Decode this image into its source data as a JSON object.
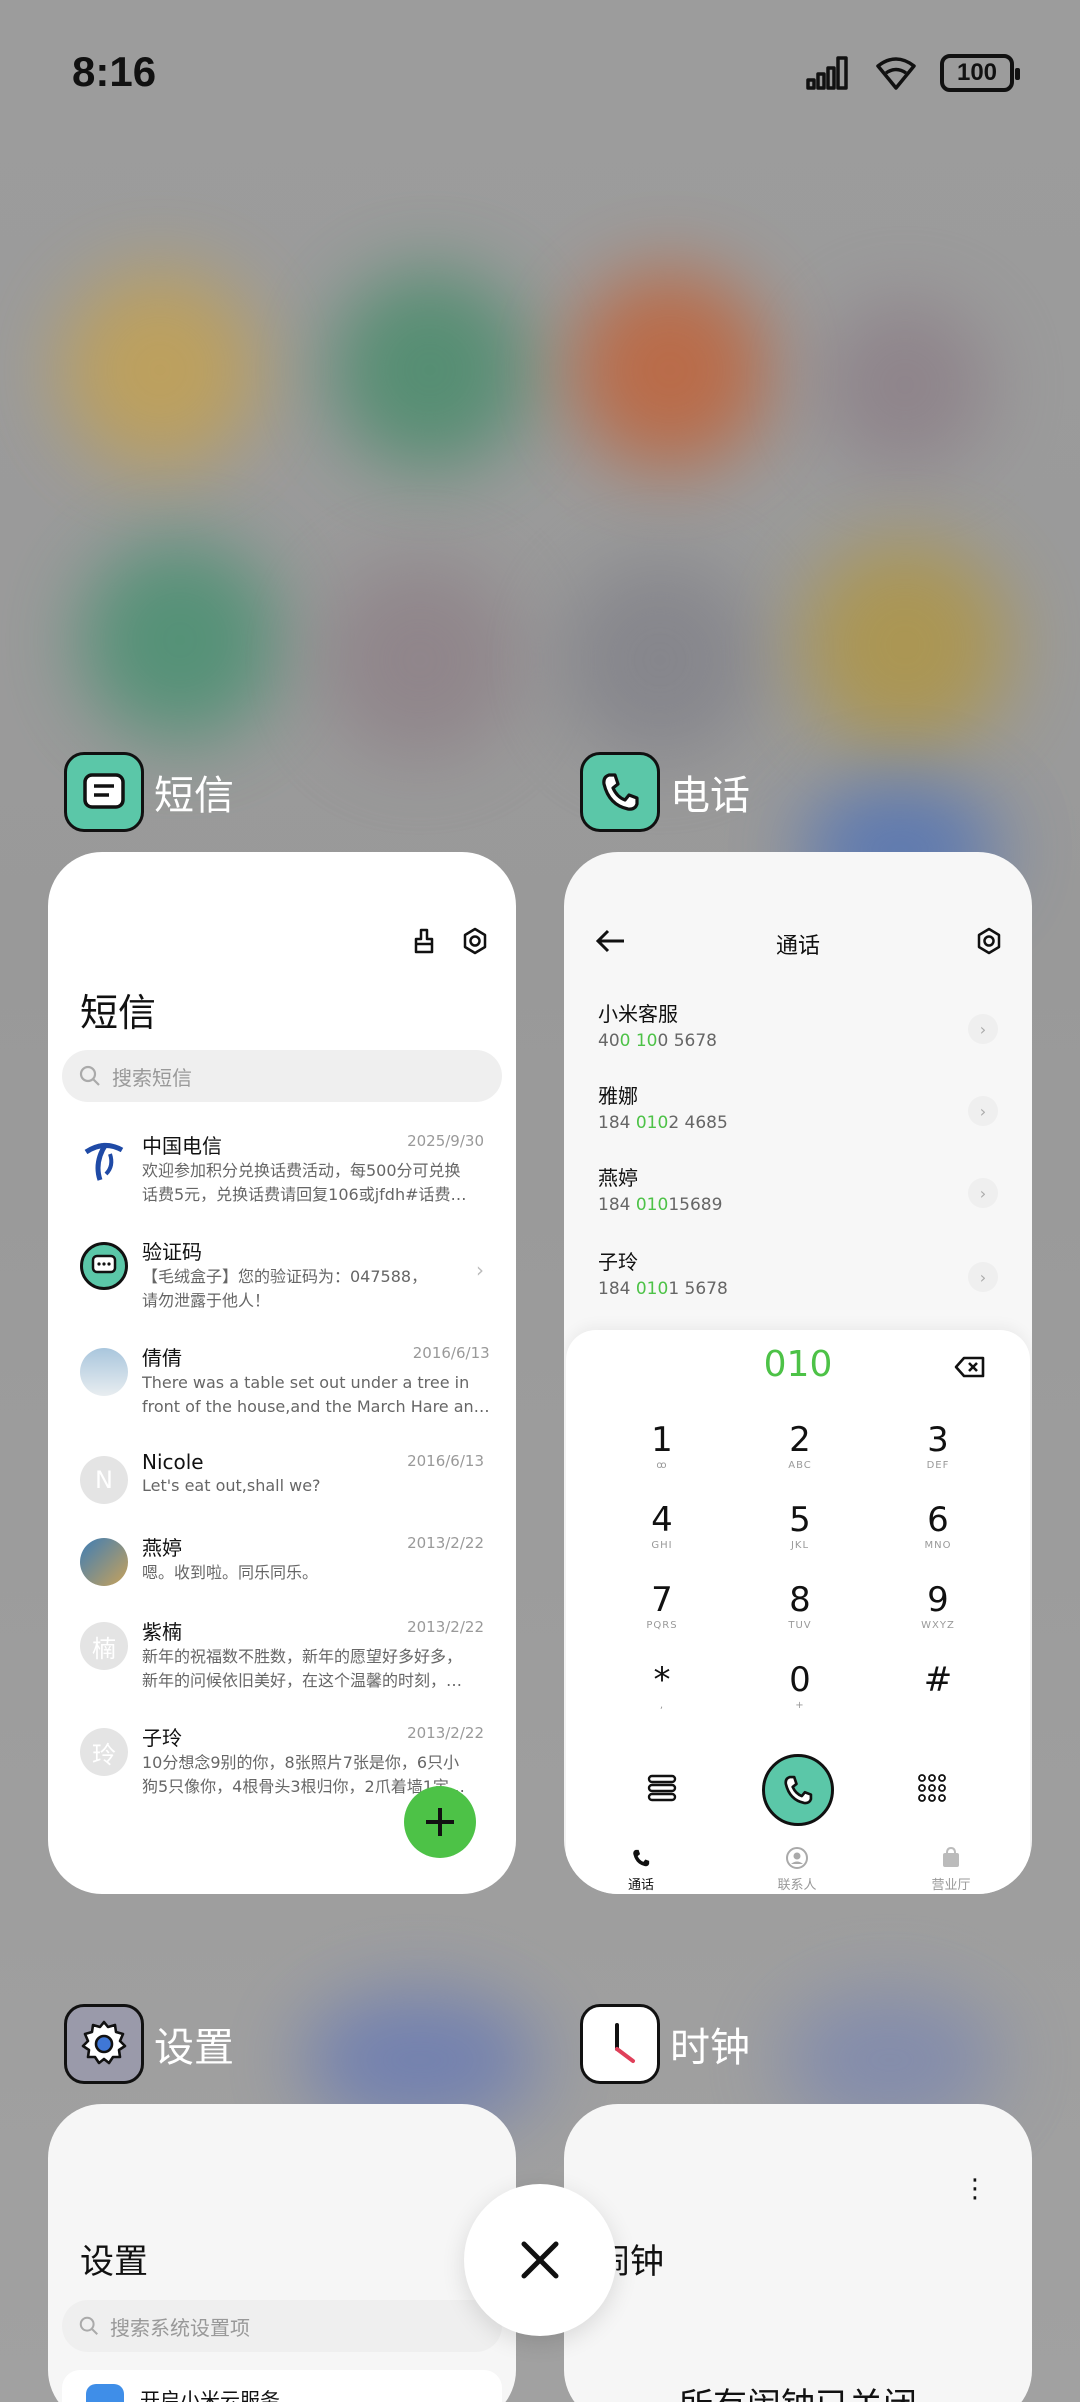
{
  "status_bar": {
    "time": "8:16",
    "battery": "100"
  },
  "apps": {
    "sms": {
      "label": "短信",
      "title": "短信",
      "search_placeholder": "搜索短信",
      "messages": [
        {
          "name": "中国电信",
          "date": "2025/9/30",
          "line1": "欢迎参加积分兑换话费活动，每500分可兑换",
          "line2": "话费5元，兑换话费请回复106或jfdh#话费…"
        },
        {
          "name": "验证码",
          "date": "",
          "line1": "【毛绒盒子】您的验证码为：047588，",
          "line2": "请勿泄露于他人！"
        },
        {
          "name": "倩倩",
          "date": "2016/6/13",
          "line1": "There was a table set out under a tree in",
          "line2": "front of the house,and the March Hare an…"
        },
        {
          "name": "Nicole",
          "date": "2016/6/13",
          "line1": "Let's eat out,shall we?",
          "line2": "",
          "avatar": "N"
        },
        {
          "name": "燕婷",
          "date": "2013/2/22",
          "line1": "嗯。收到啦。同乐同乐。",
          "line2": ""
        },
        {
          "name": "紫楠",
          "date": "2013/2/22",
          "line1": "新年的祝福数不胜数，新年的愿望好多好多，",
          "line2": "新年的问候依旧美好，在这个温馨的时刻，…",
          "avatar": "楠"
        },
        {
          "name": "子玲",
          "date": "2013/2/22",
          "line1": "10分想念9别的你，8张照片7张是你，6只小",
          "line2": "狗5只像你，4根骨头3根归你，2爪着墙1定…",
          "avatar": "玲"
        }
      ]
    },
    "phone": {
      "label": "电话",
      "title": "通话",
      "contacts": [
        {
          "name": "小米客服",
          "num_pre": "40",
          "num_hl": "0 10",
          "num_post": "0 5678"
        },
        {
          "name": "雅娜",
          "num_pre": "184 ",
          "num_hl": "010",
          "num_post": "2 4685"
        },
        {
          "name": "燕婷",
          "num_pre": "184 ",
          "num_hl": "010",
          "num_post": "15689"
        },
        {
          "name": "子玲",
          "num_pre": "184 ",
          "num_hl": "010",
          "num_post": "1 5678"
        }
      ],
      "dialed": "010",
      "keys": [
        {
          "k": "1",
          "s": "ꝏ"
        },
        {
          "k": "2",
          "s": "ABC"
        },
        {
          "k": "3",
          "s": "DEF"
        },
        {
          "k": "4",
          "s": "GHI"
        },
        {
          "k": "5",
          "s": "JKL"
        },
        {
          "k": "6",
          "s": "MNO"
        },
        {
          "k": "7",
          "s": "PQRS"
        },
        {
          "k": "8",
          "s": "TUV"
        },
        {
          "k": "9",
          "s": "WXYZ"
        },
        {
          "k": "*",
          "s": ","
        },
        {
          "k": "0",
          "s": "+"
        },
        {
          "k": "#",
          "s": ""
        }
      ],
      "tabs": [
        "通话",
        "联系人",
        "营业厅"
      ]
    },
    "settings": {
      "label": "设置",
      "title": "设置",
      "search_placeholder": "搜索系统设置项",
      "first_item": "开启小米云服务"
    },
    "clock": {
      "label": "时钟",
      "title": "闹钟",
      "empty_text": "所有闹钟已关闭"
    }
  },
  "colors": {
    "accent_green": "#4dc247",
    "icon_teal": "#5bc7a8"
  }
}
